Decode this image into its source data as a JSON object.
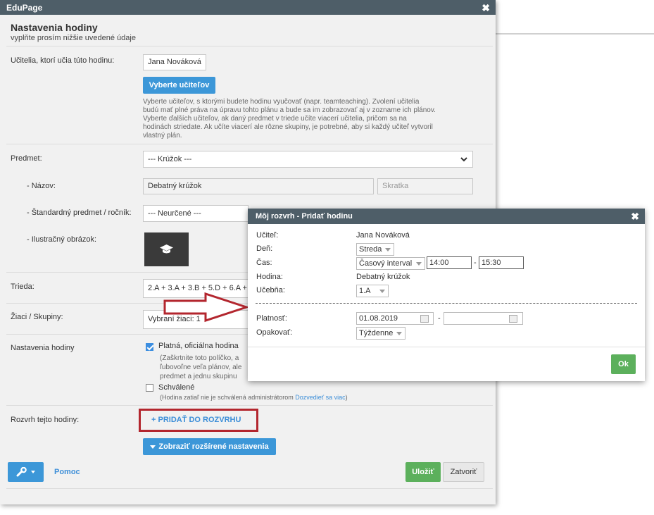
{
  "app": {
    "title": "EduPage"
  },
  "header": {
    "title": "Nastavenia hodiny",
    "subtitle": "vyplňte prosím nižšie uvedené údaje"
  },
  "teachers": {
    "label": "Učitelia, ktorí učia túto hodinu:",
    "selected": "Jana Nováková",
    "button": "Vyberte učiteľov",
    "help_lines": [
      "Vyberte učiteľov, s ktorými budete hodinu vyučovať (napr. teamteaching). Zvolení učitelia",
      "budú mať plné práva na úpravu tohto plánu a bude sa im zobrazovať aj v zozname ich plánov.",
      "Vyberte ďalších učiteľov, ak daný predmet v triede učíte viacerí učitelia, pričom sa na",
      "hodinách striedate. Ak učíte viacerí ale rôzne skupiny, je potrebné, aby si každý učiteľ vytvoril",
      "vlastný plán."
    ]
  },
  "subject": {
    "label": "Predmet:",
    "value": "--- Krúžok ---"
  },
  "name": {
    "label": "- Názov:",
    "value": "Debatný krúžok",
    "abbr_placeholder": "Skratka"
  },
  "standard": {
    "label": "- Štandardný predmet / ročník:",
    "value": "--- Neurčené ---"
  },
  "image": {
    "label": "- Ilustračný obrázok:"
  },
  "class": {
    "label": "Trieda:",
    "value": "2.A + 3.A + 3.B + 5.D + 6.A +"
  },
  "students": {
    "label": "Žiaci / Skupiny:",
    "value": "Vybraní žiaci: 1"
  },
  "settings": {
    "label": "Nastavenia hodiny",
    "official_label": "Platná, oficiálna hodina",
    "official_checked": true,
    "official_help": [
      "(Zaškrtnite toto políčko, a",
      "ľubovoľne veľa plánov, ale",
      "predmet a jednu skupinu"
    ],
    "approved_label": "Schválené",
    "approved_checked": false,
    "approved_help": "(Hodina zatiaľ nie je schválená administrátorom",
    "approved_link": "Dozvedieť sa viac",
    "approved_help_end": ")"
  },
  "schedule": {
    "label": "Rozvrh tejto hodiny:",
    "add_link": "+ PRIDAŤ DO ROZVRHU"
  },
  "advanced": {
    "button": "Zobraziť rozšírené nastavenia"
  },
  "footer": {
    "help": "Pomoc",
    "save": "Uložiť",
    "close": "Zatvoriť"
  },
  "popup": {
    "title": "Môj rozvrh - Pridať hodinu",
    "teacher_label": "Učiteľ:",
    "teacher_value": "Jana Nováková",
    "day_label": "Deň:",
    "day_value": "Streda",
    "time_label": "Čas:",
    "time_mode": "Časový interval",
    "time_from": "14:00",
    "time_dash": "-",
    "time_to": "15:30",
    "lesson_label": "Hodina:",
    "lesson_value": "Debatný krúžok",
    "room_label": "Učebňa:",
    "room_value": "1.A",
    "validity_label": "Platnosť:",
    "validity_from": "01.08.2019",
    "validity_dash": "-",
    "validity_to": "",
    "repeat_label": "Opakovať:",
    "repeat_value": "Týždenne",
    "ok": "Ok"
  },
  "colors": {
    "titlebar": "#4e5e68",
    "primary": "#3c97d8",
    "success": "#5cb05c",
    "highlight": "#b3262e"
  }
}
